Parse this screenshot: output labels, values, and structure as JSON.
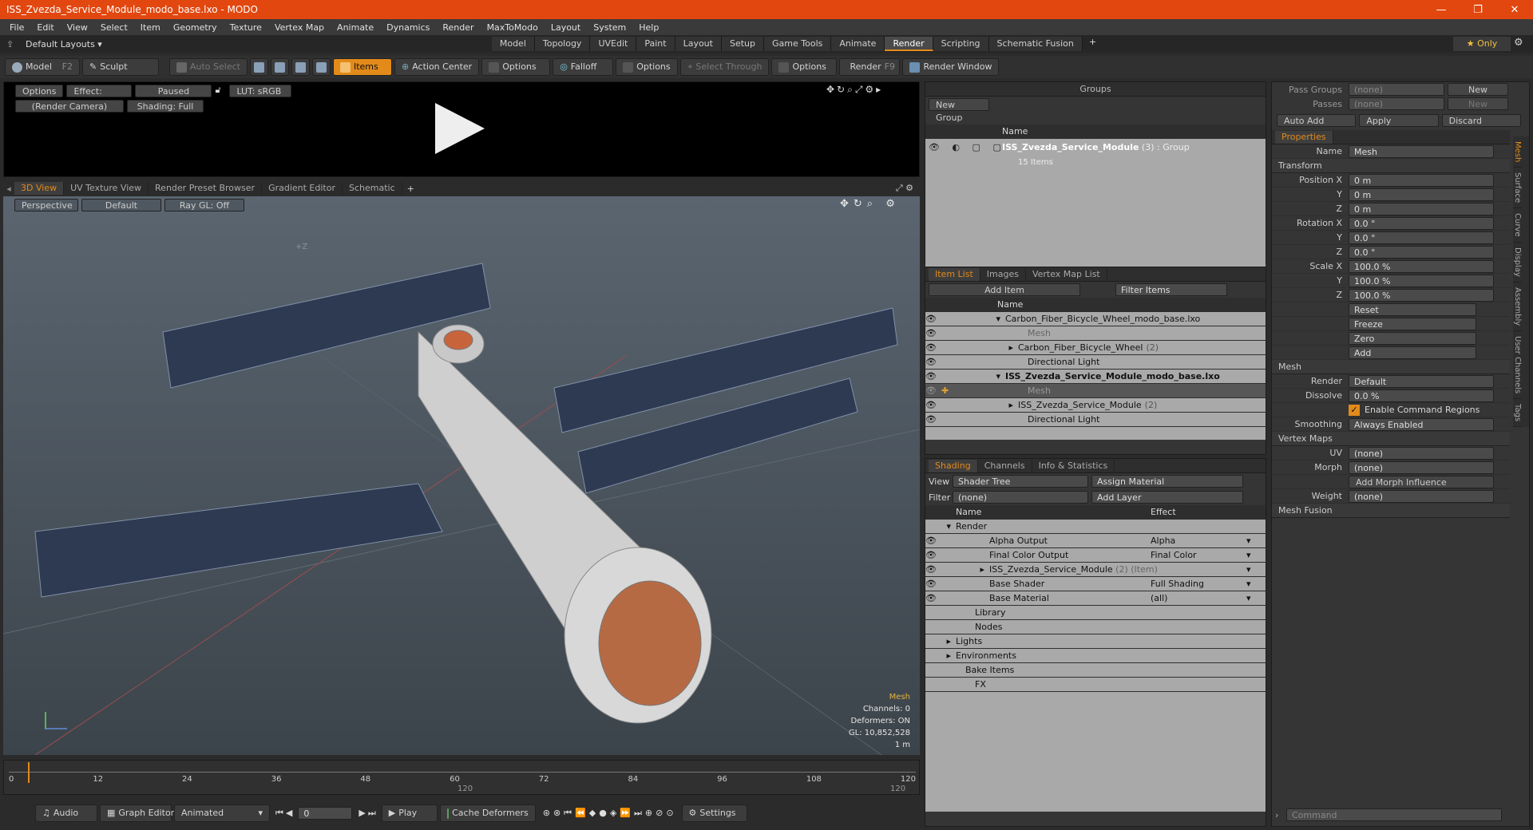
{
  "window": {
    "title": "ISS_Zvezda_Service_Module_modo_base.lxo - MODO",
    "ctl_min": "—",
    "ctl_restore": "❐",
    "ctl_close": "✕"
  },
  "menu": [
    "File",
    "Edit",
    "View",
    "Select",
    "Item",
    "Geometry",
    "Texture",
    "Vertex Map",
    "Animate",
    "Dynamics",
    "Render",
    "MaxToModo",
    "Layout",
    "System",
    "Help"
  ],
  "layout": {
    "preset": "Default Layouts ▾",
    "tabs": [
      "Model",
      "Topology",
      "UVEdit",
      "Paint",
      "Layout",
      "Setup",
      "Game Tools",
      "Animate",
      "Render",
      "Scripting",
      "Schematic Fusion"
    ],
    "active": "Render",
    "add": "+",
    "only": "★  Only",
    "gear": "⚙"
  },
  "toolbar": {
    "model": "Model",
    "model_key": "F2",
    "sculpt": "Sculpt",
    "auto_select": "Auto Select",
    "items": "Items",
    "action_center": "Action Center",
    "options1": "Options",
    "falloff": "Falloff",
    "options2": "Options",
    "select_through": "Select Through",
    "options3": "Options",
    "render": "Render",
    "render_key": "F9",
    "render_window": "Render Window"
  },
  "preview": {
    "options": "Options",
    "effect": "Effect: (Shadi...",
    "paused": "Paused",
    "lut": "LUT: sRGB",
    "camera": "(Render Camera)",
    "shading": "Shading: Full"
  },
  "viewport": {
    "tabs": [
      "3D View",
      "UV Texture View",
      "Render Preset Browser",
      "Gradient Editor",
      "Schematic"
    ],
    "add": "+",
    "perspective": "Perspective",
    "default": "Default",
    "raygl": "Ray GL: Off",
    "axis_label": "+Z",
    "info": {
      "type": "Mesh",
      "channels": "Channels: 0",
      "deformers": "Deformers: ON",
      "gl": "GL: 10,852,528",
      "scale": "1 m"
    }
  },
  "timeline": {
    "ticks": [
      "0",
      "12",
      "24",
      "36",
      "48",
      "60",
      "72",
      "84",
      "96",
      "108",
      "120"
    ],
    "sub_mid": "120",
    "sub_end": "120"
  },
  "bottombar": {
    "audio": "Audio",
    "graph_editor": "Graph Editor",
    "animated": "Animated",
    "frame": "0",
    "play": "Play",
    "cache": "Cache Deformers",
    "settings": "Settings"
  },
  "groups": {
    "title": "Groups",
    "new_group": "New Group",
    "col_name": "Name",
    "item_name": "ISS_Zvezda_Service_Module",
    "item_meta": "(3) : Group",
    "item_sub": "15 Items"
  },
  "itemlist": {
    "tabs": [
      "Item List",
      "Images",
      "Vertex Map List"
    ],
    "add_item": "Add Item",
    "filter": "Filter Items",
    "col_name": "Name",
    "rows": [
      {
        "name": "Carbon_Fiber_Bicycle_Wheel_modo_base.lxo",
        "count": "",
        "indent": 0,
        "bold": false,
        "dim": false
      },
      {
        "name": "Mesh",
        "count": "",
        "indent": 1,
        "bold": false,
        "dim": true
      },
      {
        "name": "Carbon_Fiber_Bicycle_Wheel",
        "count": "(2)",
        "indent": 1,
        "bold": false,
        "dim": false
      },
      {
        "name": "Directional Light",
        "count": "",
        "indent": 1,
        "bold": false,
        "dim": false
      },
      {
        "name": "ISS_Zvezda_Service_Module_modo_base.lxo",
        "count": "",
        "indent": 0,
        "bold": true,
        "dim": false
      },
      {
        "name": "Mesh",
        "count": "",
        "indent": 1,
        "bold": false,
        "dim": true,
        "selected": true
      },
      {
        "name": "ISS_Zvezda_Service_Module",
        "count": "(2)",
        "indent": 1,
        "bold": false,
        "dim": false
      },
      {
        "name": "Directional Light",
        "count": "",
        "indent": 1,
        "bold": false,
        "dim": false
      }
    ]
  },
  "shading": {
    "tabs": [
      "Shading",
      "Channels",
      "Info & Statistics"
    ],
    "view_label": "View",
    "view": "Shader Tree",
    "assign": "Assign Material",
    "filter_label": "Filter",
    "filter": "(none)",
    "add_layer": "Add Layer",
    "col_name": "Name",
    "col_effect": "Effect",
    "rows": [
      {
        "name": "Render",
        "effect": "",
        "indent": 0
      },
      {
        "name": "Alpha Output",
        "effect": "Alpha",
        "indent": 1
      },
      {
        "name": "Final Color Output",
        "effect": "Final Color",
        "indent": 1
      },
      {
        "name": "ISS_Zvezda_Service_Module",
        "meta": "(2) (Item)",
        "effect": "",
        "indent": 1
      },
      {
        "name": "Base Shader",
        "effect": "Full Shading",
        "indent": 1
      },
      {
        "name": "Base Material",
        "effect": "(all)",
        "indent": 1
      },
      {
        "name": "Library",
        "effect": "",
        "indent": 0
      },
      {
        "name": "Nodes",
        "effect": "",
        "indent": 0
      },
      {
        "name": "Lights",
        "effect": "",
        "indent": 0
      },
      {
        "name": "Environments",
        "effect": "",
        "indent": 0
      },
      {
        "name": "Bake Items",
        "effect": "",
        "indent": 0
      },
      {
        "name": "FX",
        "effect": "",
        "indent": 0
      }
    ]
  },
  "properties": {
    "pass_groups_label": "Pass Groups",
    "pass_groups": "(none)",
    "passes_label": "Passes",
    "passes": "(none)",
    "new1": "New",
    "new2": "New",
    "auto_add": "Auto Add",
    "apply": "Apply",
    "discard": "Discard",
    "tab": "Properties",
    "name_label": "Name",
    "name": "Mesh",
    "transform": "Transform",
    "pos_label": "Position X",
    "pos": [
      "0 m",
      "0 m",
      "0 m"
    ],
    "rot_label": "Rotation X",
    "rot": [
      "0.0 °",
      "0.0 °",
      "0.0 °"
    ],
    "scale_label": "Scale X",
    "scale": [
      "100.0 %",
      "100.0 %",
      "100.0 %"
    ],
    "y": "Y",
    "z": "Z",
    "reset": "Reset",
    "freeze": "Freeze",
    "zero": "Zero",
    "add": "Add",
    "mesh": "Mesh",
    "render_label": "Render",
    "render": "Default",
    "dissolve_label": "Dissolve",
    "dissolve": "0.0 %",
    "cmd_regions": "Enable Command Regions",
    "smoothing_label": "Smoothing",
    "smoothing": "Always Enabled",
    "vertex_maps": "Vertex Maps",
    "uv_label": "UV",
    "uv": "(none)",
    "morph_label": "Morph",
    "morph": "(none)",
    "add_morph": "Add Morph Influence",
    "weight_label": "Weight",
    "weight": "(none)",
    "mesh_fusion": "Mesh Fusion",
    "side_tabs": [
      "Mesh",
      "Surface",
      "Curve",
      "Display",
      "Assembly",
      "User Channels",
      "Tags"
    ],
    "command": "Command"
  }
}
